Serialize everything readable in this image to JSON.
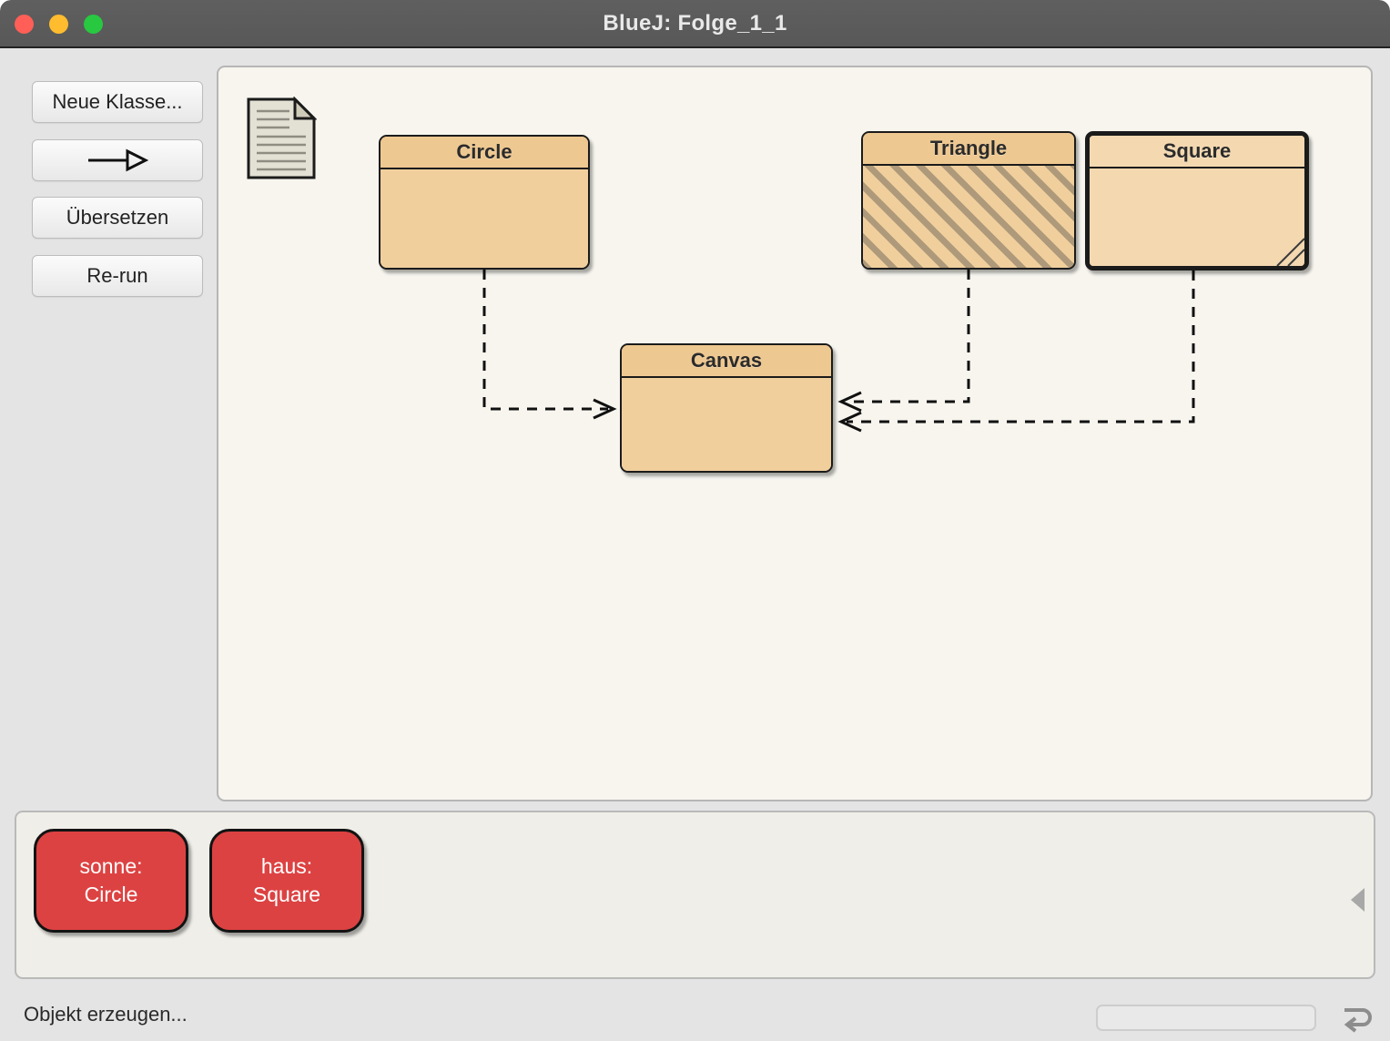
{
  "window": {
    "title": "BlueJ:  Folge_1_1",
    "traffic_lights": [
      {
        "name": "close",
        "color": "#ff5f57"
      },
      {
        "name": "minimize",
        "color": "#febc2e"
      },
      {
        "name": "maximize",
        "color": "#28c840"
      }
    ]
  },
  "toolbar": {
    "new_class_label": "Neue Klasse...",
    "arrow_label": "",
    "arrow_icon": "arrow-right-open-icon",
    "compile_label": "Übersetzen",
    "rerun_label": "Re-run",
    "collapse_icon": "triangle-up-icon"
  },
  "diagram": {
    "readme_icon": "document-note-icon",
    "classes": [
      {
        "name": "Circle",
        "state": "compiled",
        "selected": false
      },
      {
        "name": "Triangle",
        "state": "uncompiled",
        "selected": false
      },
      {
        "name": "Square",
        "state": "compiled",
        "selected": true
      },
      {
        "name": "Canvas",
        "state": "compiled",
        "selected": false
      }
    ],
    "dependencies": [
      {
        "from": "Circle",
        "to": "Canvas",
        "type": "uses"
      },
      {
        "from": "Triangle",
        "to": "Canvas",
        "type": "uses"
      },
      {
        "from": "Square",
        "to": "Canvas",
        "type": "uses"
      }
    ]
  },
  "object_bench": {
    "objects": [
      {
        "instance": "sonne:",
        "type": "Circle"
      },
      {
        "instance": "haus:",
        "type": "Square"
      }
    ],
    "collapse_icon": "triangle-left-icon",
    "object_color": "#dd4242"
  },
  "statusbar": {
    "message": "Objekt erzeugen...",
    "progress_value": 0,
    "loop_icon": "loop-arrow-icon"
  },
  "colors": {
    "class_fill": "#f0cf9d",
    "class_header": "#eec891",
    "class_selected_fill": "#f3d8b0",
    "diagram_bg": "#f7f5ee",
    "window_bg": "#e4e4e4",
    "titlebar_bg": "#5c5c5c",
    "object_red": "#dd4242"
  }
}
